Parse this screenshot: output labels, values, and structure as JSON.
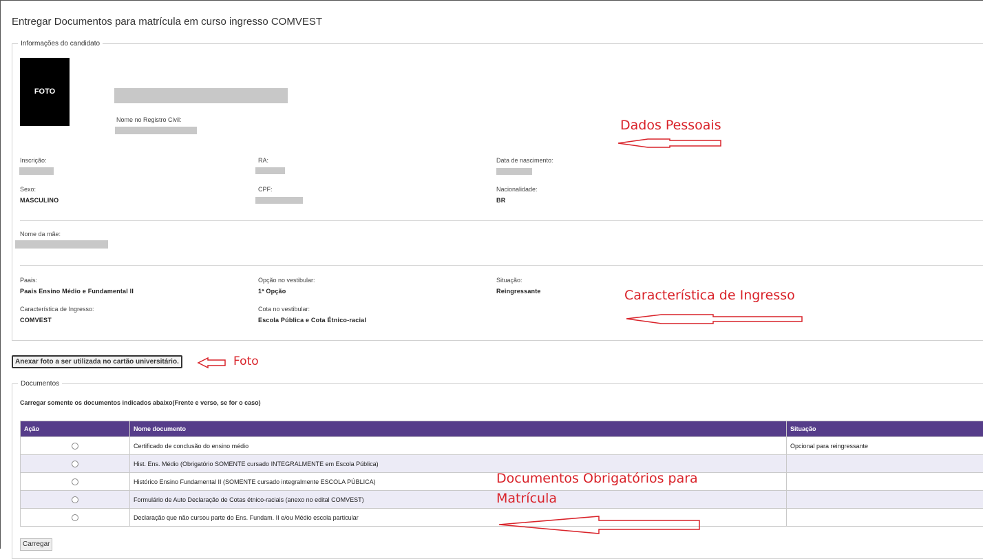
{
  "page_title": "Entregar Documentos para matrícula em curso ingresso COMVEST",
  "info": {
    "legend": "Informações do candidato",
    "photo_label": "FOTO",
    "civil_name_label": "Nome no Registro Civil:",
    "inscricao_label": "Inscrição:",
    "ra_label": "RA:",
    "birth_label": "Data de nascimento:",
    "sex_label": "Sexo:",
    "sex_value": "MASCULINO",
    "cpf_label": "CPF:",
    "nationality_label": "Nacionalidade:",
    "nationality_value": "BR",
    "mother_label": "Nome da mãe:",
    "paais_label": "Paais:",
    "paais_value": "Paais Ensino Médio e Fundamental II",
    "option_label": "Opção no vestibular:",
    "option_value": "1ª Opção",
    "situation_label": "Situação:",
    "situation_value": "Reingressante",
    "entry_label": "Característica de Ingresso:",
    "entry_value": "COMVEST",
    "quota_label": "Cota no vestibular:",
    "quota_value": "Escola Pública e Cota Étnico-racial"
  },
  "attach_photo_button": "Anexar foto a ser utilizada no cartão universitário.",
  "documents": {
    "legend": "Documentos",
    "note": "Carregar somente os documentos indicados abaixo(Frente e verso, se for o caso)",
    "columns": [
      "Ação",
      "Nome documento",
      "Situação"
    ],
    "rows": [
      {
        "name": "Certificado de conclusão do ensino médio",
        "status": "Opcional para reingressante"
      },
      {
        "name": "Hist. Ens. Médio (Obrigatório SOMENTE cursado INTEGRALMENTE em Escola Pública)",
        "status": ""
      },
      {
        "name": "Histórico Ensino Fundamental II (SOMENTE cursado integralmente ESCOLA PÚBLICA)",
        "status": ""
      },
      {
        "name": "Formulário de Auto Declaração de Cotas étnico-raciais (anexo no edital COMVEST)",
        "status": ""
      },
      {
        "name": "Declaração que não cursou parte do Ens. Fundam. II e/ou Médio escola particular",
        "status": ""
      }
    ],
    "upload_button": "Carregar"
  },
  "annotations": {
    "personal": "Dados Pessoais",
    "entry": "Característica de Ingresso",
    "photo": "Foto",
    "docs_line1": "Documentos Obrigatórios para",
    "docs_line2": "Matrícula"
  },
  "colors": {
    "table_header": "#563d8a",
    "alt_row": "#ecebf6",
    "annotation": "#d9232a"
  }
}
